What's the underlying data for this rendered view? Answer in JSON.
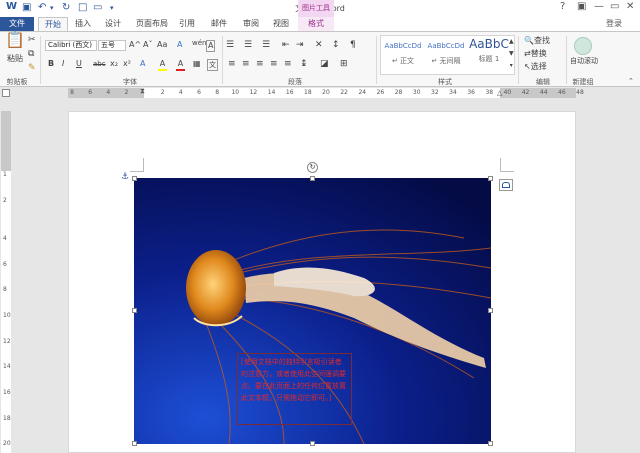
{
  "titlebar": {
    "title": "文档1 - Word",
    "context_group": "图片工具",
    "help": "?",
    "min": "—",
    "restore": "▭",
    "close": "✕"
  },
  "tabs": [
    {
      "label": "文件"
    },
    {
      "label": "开始"
    },
    {
      "label": "插入"
    },
    {
      "label": "设计"
    },
    {
      "label": "页面布局"
    },
    {
      "label": "引用"
    },
    {
      "label": "邮件"
    },
    {
      "label": "审阅"
    },
    {
      "label": "视图"
    },
    {
      "label": "格式"
    }
  ],
  "login": "登录",
  "ribbon": {
    "clipboard": {
      "paste": "粘贴",
      "label": "剪贴板"
    },
    "font": {
      "name": "Calibri (西文)",
      "size": "五号",
      "label": "字体",
      "buttons": {
        "bold": "B",
        "italic": "I",
        "underline": "U",
        "strike": "abc",
        "sub": "x₂",
        "sup": "x²",
        "grow": "A^",
        "shrink": "Aˇ",
        "case": "Aa",
        "clear": "A",
        "highlight": "A",
        "fontcolor": "A",
        "wen": "文",
        "a1": "A",
        "phon": "wén"
      },
      "colors": {
        "font": "#e02020",
        "highlight": "#ffff00"
      }
    },
    "paragraph": {
      "label": "段落"
    },
    "styles": {
      "label": "样式",
      "items": [
        {
          "sample": "AaBbCcDd",
          "name": "↵ 正文"
        },
        {
          "sample": "AaBbCcDd",
          "name": "↵ 无间隔"
        },
        {
          "sample": "AaBbC",
          "name": "标题 1"
        }
      ]
    },
    "editing": {
      "label": "编辑",
      "find": "查找",
      "replace": "替换",
      "select": "选择"
    },
    "newgroup": {
      "label": "新建组",
      "button": "自动滚动"
    }
  },
  "ruler": {
    "h_ticks": [
      "8",
      "6",
      "4",
      "2",
      "",
      "2",
      "4",
      "6",
      "8",
      "10",
      "12",
      "14",
      "16",
      "18",
      "20",
      "22",
      "24",
      "26",
      "28",
      "30",
      "32",
      "34",
      "36",
      "38",
      "40",
      "42",
      "44",
      "46",
      "48"
    ],
    "v_ticks": [
      "1",
      "",
      "2",
      "",
      "",
      "4",
      "",
      "6",
      "",
      "8",
      "",
      "10",
      "",
      "12",
      "",
      "14",
      "",
      "16",
      "",
      "18",
      "",
      "20"
    ]
  },
  "document": {
    "textbox_text": "[使用文档中的独特引言吸引读者的注意力，或者使用此空间强调要点。要在此页面上的任何位置放置此文本框，只需拖动它即可。]"
  }
}
